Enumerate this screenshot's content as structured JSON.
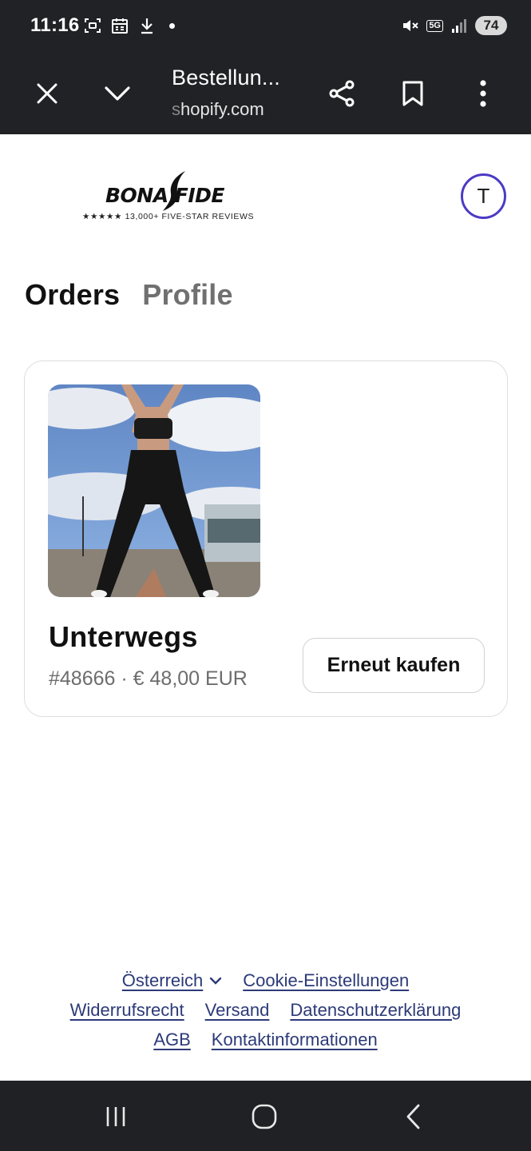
{
  "status_bar": {
    "time": "11:16",
    "network": "5G",
    "battery": "74",
    "icons": [
      "screenshot-icon",
      "calendar-icon",
      "download-icon",
      "notification-dot",
      "mute-icon",
      "signal-icon"
    ]
  },
  "browser": {
    "page_title": "Bestellun...",
    "url_faded": "s",
    "url": "hopify.com",
    "icons": [
      "close-icon",
      "chevron-down-icon",
      "share-icon",
      "bookmark-icon",
      "more-vert-icon"
    ]
  },
  "store": {
    "logo_text": "BONA FIDE",
    "logo_tagline": "★★★★★ 13,000+ FIVE-STAR REVIEWS",
    "avatar_initial": "T"
  },
  "tabs": [
    {
      "label": "Orders",
      "active": true
    },
    {
      "label": "Profile",
      "active": false
    }
  ],
  "order": {
    "status": "Unterwegs",
    "number": "#48666",
    "separator": "·",
    "total": "€ 48,00 EUR",
    "buy_again_label": "Erneut kaufen",
    "image": "product-photo-leggings"
  },
  "footer": {
    "country": "Österreich",
    "cookie": "Cookie-Einstellungen",
    "withdrawal": "Widerrufsrecht",
    "shipping": "Versand",
    "privacy": "Datenschutzerklärung",
    "terms": "AGB",
    "contact": "Kontaktinformationen"
  },
  "colors": {
    "chrome_bg": "#212226",
    "avatar_ring": "#4b3bc4",
    "link": "#2c3a78",
    "muted_text": "#707070"
  }
}
